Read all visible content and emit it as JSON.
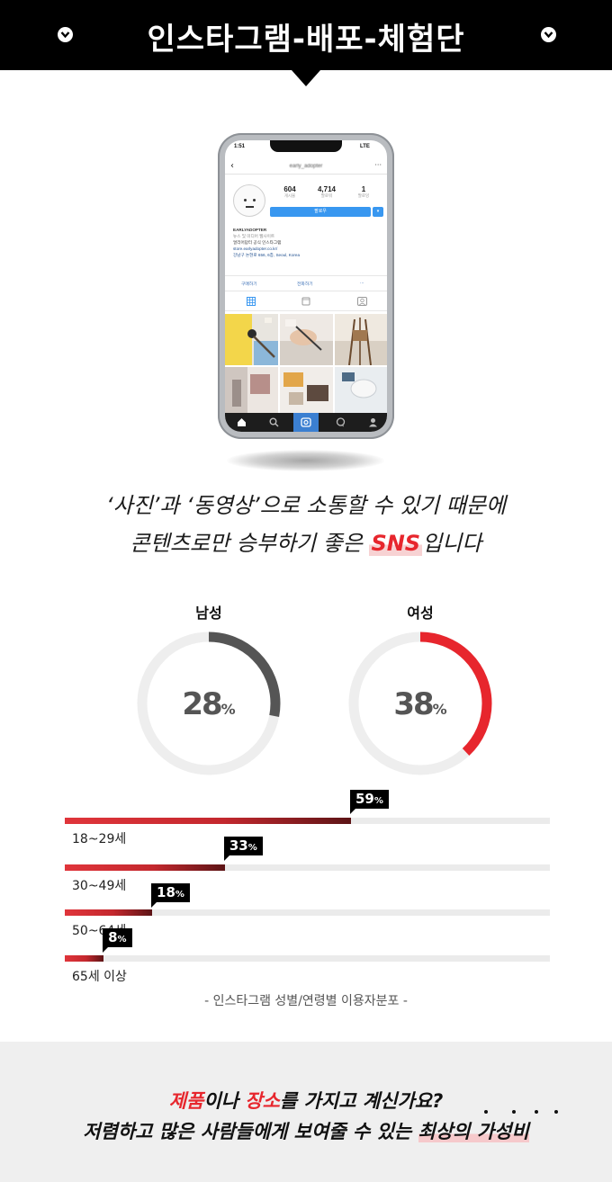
{
  "header": {
    "title": "인스타그램-배포-체험단"
  },
  "phone": {
    "time": "1:51",
    "signal": "LTE",
    "username": "early_adopter",
    "stats": [
      {
        "value": "604",
        "label": "게시물"
      },
      {
        "value": "4,714",
        "label": "팔로워"
      },
      {
        "value": "1",
        "label": "팔로잉"
      }
    ],
    "follow_label": "팔로우",
    "bio": [
      "EARLYADOPTER",
      "뉴스 및 미디어 웹사이트",
      "얼리어답터 공식 인스타그램",
      "store.earlyadopter.co.kr/",
      "강남구 논현로 656, 6층, Seoul, Korea"
    ],
    "actions": [
      "구매하기",
      "전화하기",
      "..."
    ]
  },
  "intro": {
    "line1": "‘사진’과 ‘동영상’으로 소통할 수 있기 때문에",
    "line2_pre": "콘텐츠로만 승부하기 좋은 ",
    "line2_hl": "SNS",
    "line2_post": "입니다"
  },
  "gender": [
    {
      "label": "남성",
      "value": 28,
      "value_text": "28",
      "unit": "%",
      "color": "#555555"
    },
    {
      "label": "여성",
      "value": 38,
      "value_text": "38",
      "unit": "%",
      "color": "#e7262d"
    }
  ],
  "age": [
    {
      "label": "18~29세",
      "value": 59,
      "value_text": "59",
      "unit": "%"
    },
    {
      "label": "30~49세",
      "value": 33,
      "value_text": "33",
      "unit": "%"
    },
    {
      "label": "50~64세",
      "value": 18,
      "value_text": "18",
      "unit": "%"
    },
    {
      "label": "65세 이상",
      "value": 8,
      "value_text": "8",
      "unit": "%"
    }
  ],
  "caption": "- 인스타그램 성별/연령별 이용자분포 -",
  "footer": {
    "l1_a": "제품",
    "l1_b": "이나 ",
    "l1_c": "장소",
    "l1_d": "를 가지고 계신가요?",
    "l2_a": "저렴하고 많은 사람들에게 보여줄 수 있는 ",
    "l2_b": "최상의 가성비"
  }
}
